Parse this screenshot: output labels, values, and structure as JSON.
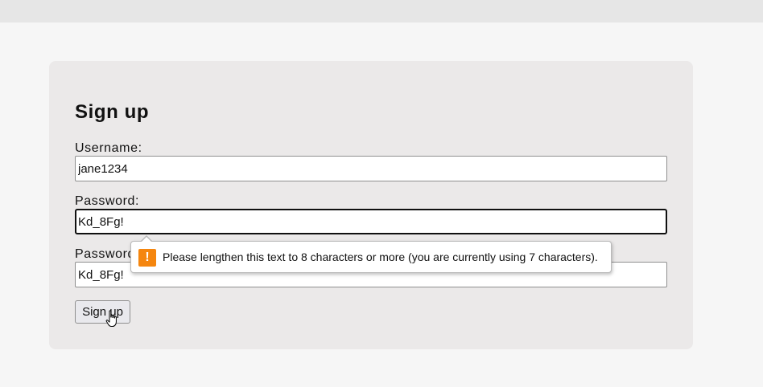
{
  "form": {
    "title": "Sign up",
    "username_label": "Username:",
    "username_value": "jane1234",
    "password_label": "Password:",
    "password_value": "Kd_8Fg!",
    "confirm_label": "Password:",
    "confirm_value": "Kd_8Fg!",
    "submit_label": "Sign up"
  },
  "validation": {
    "message": "Please lengthen this text to 8 characters or more (you are currently using 7 characters).",
    "icon": "warning-icon",
    "icon_glyph": "!",
    "icon_color": "#f5860f"
  },
  "cursor": {
    "icon": "hand-pointer-icon"
  }
}
